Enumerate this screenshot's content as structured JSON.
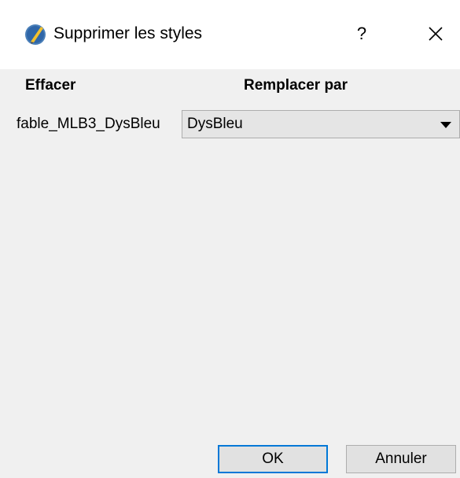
{
  "window": {
    "title": "Supprimer les styles",
    "help_label": "?",
    "close_icon": "close-icon",
    "app_icon": "app-icon"
  },
  "table": {
    "headers": {
      "delete": "Effacer",
      "replace": "Remplacer par"
    },
    "rows": [
      {
        "style": "fable_MLB3_DysBleu",
        "replacement": "DysBleu"
      }
    ]
  },
  "buttons": {
    "ok": "OK",
    "cancel": "Annuler"
  },
  "colors": {
    "default_button_border": "#0078d7",
    "dialog_background": "#f0f0f0"
  }
}
